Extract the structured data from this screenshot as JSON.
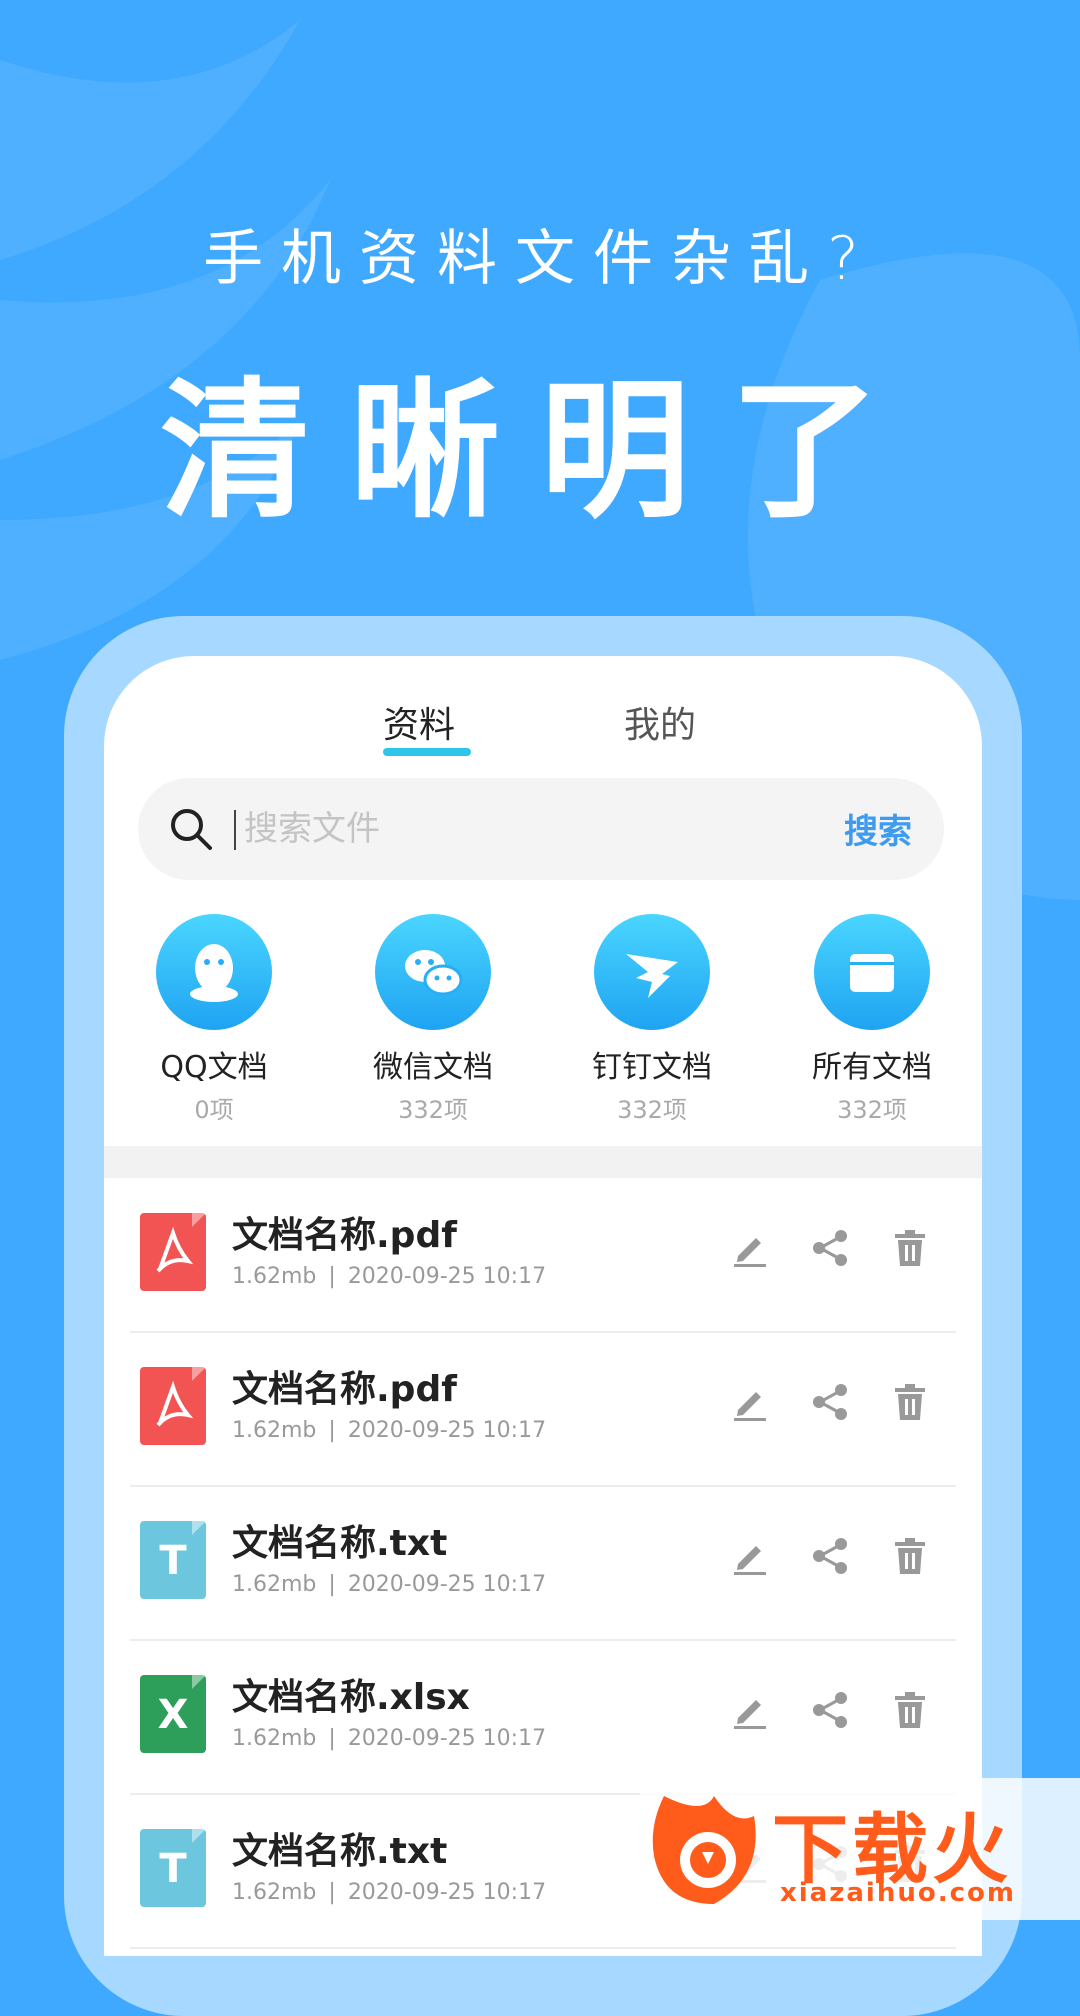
{
  "hero": {
    "subtitle": "手机资料文件杂乱?",
    "headline": "清晰明了"
  },
  "tabs": [
    {
      "label": "资料",
      "active": true
    },
    {
      "label": "我的",
      "active": false
    }
  ],
  "search": {
    "placeholder": "搜索文件",
    "button_label": "搜索",
    "icon": "search-icon"
  },
  "categories": [
    {
      "label": "QQ文档",
      "count": "0项",
      "icon": "qq-icon"
    },
    {
      "label": "微信文档",
      "count": "332项",
      "icon": "wechat-icon"
    },
    {
      "label": "钉钉文档",
      "count": "332项",
      "icon": "dingtalk-icon"
    },
    {
      "label": "所有文档",
      "count": "332项",
      "icon": "folder-icon"
    }
  ],
  "files": [
    {
      "name": "文档名称.pdf",
      "size": "1.62mb",
      "separator": "|",
      "date": "2020-09-25 10:17",
      "type": "pdf",
      "color": "#f25353"
    },
    {
      "name": "文档名称.pdf",
      "size": "1.62mb",
      "separator": "|",
      "date": "2020-09-25 10:17",
      "type": "pdf",
      "color": "#f25353"
    },
    {
      "name": "文档名称.txt",
      "size": "1.62mb",
      "separator": "|",
      "date": "2020-09-25 10:17",
      "type": "txt",
      "glyph": "T",
      "color": "#6cc6de"
    },
    {
      "name": "文档名称.xlsx",
      "size": "1.62mb",
      "separator": "|",
      "date": "2020-09-25 10:17",
      "type": "xlsx",
      "glyph": "X",
      "color": "#2e9e5b"
    },
    {
      "name": "文档名称.txt",
      "size": "1.62mb",
      "separator": "|",
      "date": "2020-09-25 10:17",
      "type": "txt",
      "glyph": "T",
      "color": "#6cc6de"
    }
  ],
  "row_actions": [
    "edit-icon",
    "share-icon",
    "delete-icon"
  ],
  "watermark": {
    "title": "下载火",
    "domain": "xiazaihuo.com"
  },
  "colors": {
    "background": "#3fa9ff",
    "accent_underline": "#2ec6e8",
    "search_button": "#3d9cf2",
    "watermark": "#ff5b1a"
  }
}
